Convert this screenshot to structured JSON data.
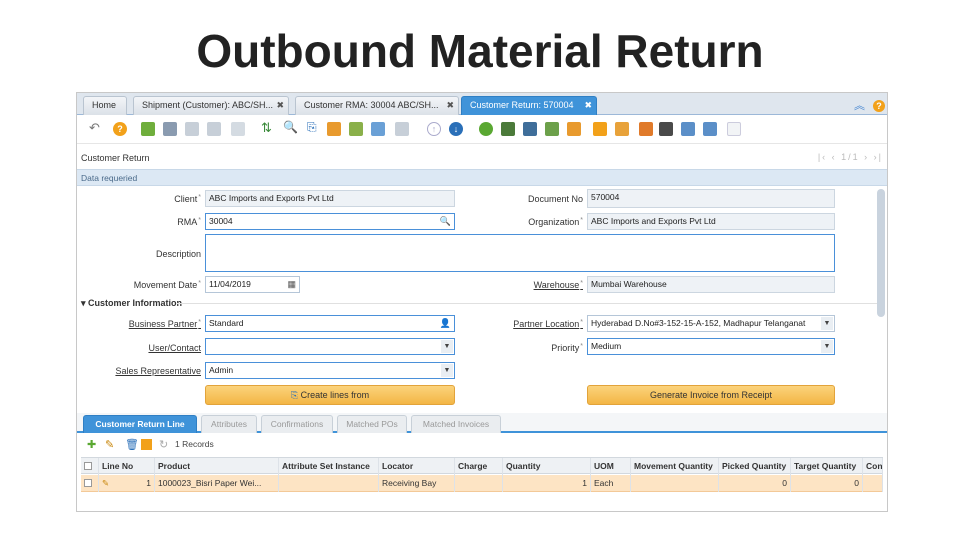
{
  "slide": {
    "title": "Outbound Material Return"
  },
  "tabs": [
    {
      "label": "Home",
      "closable": false,
      "active": false
    },
    {
      "label": "Shipment (Customer): ABC/SH...",
      "closable": true,
      "active": false
    },
    {
      "label": "Customer RMA: 30004 ABC/SH...",
      "closable": true,
      "active": false
    },
    {
      "label": "Customer Return: 570004",
      "closable": true,
      "active": true
    }
  ],
  "header": {
    "title": "Customer Return",
    "nav": "|‹ ‹ 1/1 › ›|",
    "status": "Data requeried"
  },
  "fields": {
    "client": {
      "label": "Client",
      "value": "ABC Imports and Exports Pvt Ltd"
    },
    "document_no": {
      "label": "Document No",
      "value": "570004"
    },
    "rma": {
      "label": "RMA",
      "value": "30004"
    },
    "organization": {
      "label": "Organization",
      "value": "ABC Imports and Exports Pvt Ltd"
    },
    "description": {
      "label": "Description",
      "value": ""
    },
    "movement_date": {
      "label": "Movement Date",
      "value": "11/04/2019"
    },
    "warehouse": {
      "label": "Warehouse",
      "value": "Mumbai Warehouse"
    },
    "business_partner": {
      "label": "Business Partner",
      "value": "Standard"
    },
    "partner_location": {
      "label": "Partner Location",
      "value": "Hyderabad D.No#3-152-15-A-152, Madhapur Telanganat"
    },
    "user_contact": {
      "label": "User/Contact",
      "value": ""
    },
    "priority": {
      "label": "Priority",
      "value": "Medium"
    },
    "sales_rep": {
      "label": "Sales Representative",
      "value": "Admin"
    }
  },
  "section": {
    "label": "Customer Information"
  },
  "buttons": {
    "create_lines": "Create lines from",
    "generate_invoice": "Generate Invoice from Receipt"
  },
  "detail_tabs": [
    {
      "label": "Customer Return Line",
      "active": true
    },
    {
      "label": "Attributes",
      "active": false
    },
    {
      "label": "Confirmations",
      "active": false
    },
    {
      "label": "Matched POs",
      "active": false
    },
    {
      "label": "Matched Invoices",
      "active": false
    }
  ],
  "grid": {
    "records": "1 Records",
    "columns": [
      "Line No",
      "Product",
      "Attribute Set Instance",
      "Locator",
      "Charge",
      "Quantity",
      "UOM",
      "Movement Quantity",
      "Picked Quantity",
      "Target Quantity",
      "Con"
    ],
    "rows": [
      [
        "1",
        "1000023_Bisri Paper Wei...",
        "",
        "Receiving Bay",
        "",
        "1",
        "Each",
        "",
        "0",
        "0",
        ""
      ]
    ]
  },
  "colors": {
    "accent": "#3f93d9",
    "button": "#f3b645",
    "row_selected": "#fde4c4"
  }
}
